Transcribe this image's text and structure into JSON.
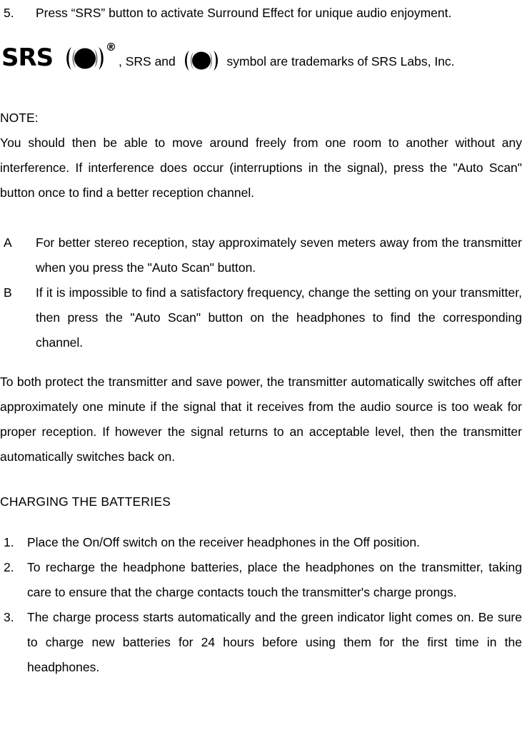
{
  "document": {
    "sections": {
      "step5": {
        "marker": "5.",
        "text": "Press “SRS” button to activate Surround Effect for unique audio enjoyment."
      },
      "trademark": {
        "logo_alt": "SRS(●) registered logo",
        "logo_word": "SRS",
        "registered_mark": "®",
        "text_before_symbol": ", SRS and",
        "text_after_symbol": "symbol are trademarks of SRS Labs, Inc."
      },
      "note": {
        "label": "NOTE:",
        "body": "You should then be able to move around freely from one room to another without any interference. If interference does occur (interruptions in the signal), press the \"Auto Scan\" button once to find a better reception channel."
      },
      "lettered_list": [
        {
          "marker": "A",
          "text": "For better stereo reception, stay approximately seven meters away from the transmitter when you press the \"Auto Scan\" button."
        },
        {
          "marker": "B",
          "text": "If it is impossible to find a satisfactory frequency, change the setting on your transmitter, then press the \"Auto Scan\" button on the headphones to find the corresponding channel."
        }
      ],
      "protect_paragraph": {
        "text": "To both protect the transmitter and save power, the transmitter automatically switches off after approximately one minute if the signal that it receives from the audio source is too weak for proper reception. If however the signal returns to an acceptable level, then the transmitter automatically switches back on."
      },
      "charging_heading": {
        "text": "CHARGING THE BATTERIES"
      },
      "charging_steps": [
        {
          "marker": "1.",
          "text": "Place the On/Off switch on the receiver headphones in the Off position."
        },
        {
          "marker": "2.",
          "text": "To recharge the headphone batteries, place the headphones on the transmitter, taking care to ensure that the charge contacts touch the transmitter's charge prongs."
        },
        {
          "marker": "3.",
          "text": "The charge process starts automatically and the green indicator light comes on. Be sure to charge new batteries for 24 hours before using them for the first time in the headphones."
        }
      ]
    },
    "colors": {
      "text": "#000000",
      "background": "#ffffff"
    }
  }
}
